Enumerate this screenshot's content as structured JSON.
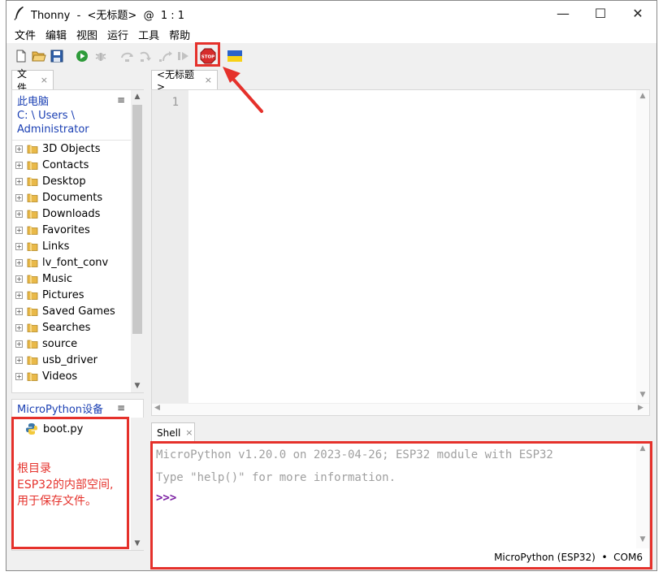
{
  "window": {
    "title": "Thonny  -  <无标题>  @  1 : 1",
    "minimize": "—",
    "maximize": "☐",
    "close": "✕"
  },
  "menu": [
    "文件",
    "编辑",
    "视图",
    "运行",
    "工具",
    "帮助"
  ],
  "toolbar": {
    "icons": [
      "new-file-icon",
      "open-folder-icon",
      "save-icon",
      "run-icon",
      "debug-icon",
      "step-over-icon",
      "step-into-icon",
      "step-out-icon",
      "resume-icon",
      "stop-icon",
      "ukraine-flag-icon"
    ],
    "stop_label": "STOP"
  },
  "files": {
    "tab_label": "文件",
    "tab_close": "×",
    "path": [
      "此电脑",
      "C: \\ Users \\",
      "Administrator"
    ],
    "menu_glyph": "≡",
    "items": [
      "3D Objects",
      "Contacts",
      "Desktop",
      "Documents",
      "Downloads",
      "Favorites",
      "Links",
      "lv_font_conv",
      "Music",
      "Pictures",
      "Saved Games",
      "Searches",
      "source",
      "usb_driver",
      "Videos"
    ],
    "expander": "+"
  },
  "device": {
    "title": "MicroPython设备",
    "menu_glyph": "≡",
    "file": "boot.py"
  },
  "editor": {
    "tab_label": "<无标题>",
    "tab_close": "×",
    "line_number": "1"
  },
  "shell": {
    "tab_label": "Shell",
    "tab_close": "×",
    "lines": [
      "MicroPython v1.20.0 on 2023-04-26; ESP32 module with ESP32",
      "Type \"help()\" for more information."
    ],
    "prompt": ">>>"
  },
  "status": {
    "interpreter": "MicroPython (ESP32)  •  COM6"
  },
  "annotation": {
    "lines": [
      "根目录",
      "ESP32的内部空间,",
      "用于保存文件。"
    ]
  },
  "colors": {
    "annotation_red": "#e5312b",
    "link_blue": "#1a3fb3",
    "prompt_purple": "#7b1fa2",
    "run_green": "#2e9b3a"
  }
}
